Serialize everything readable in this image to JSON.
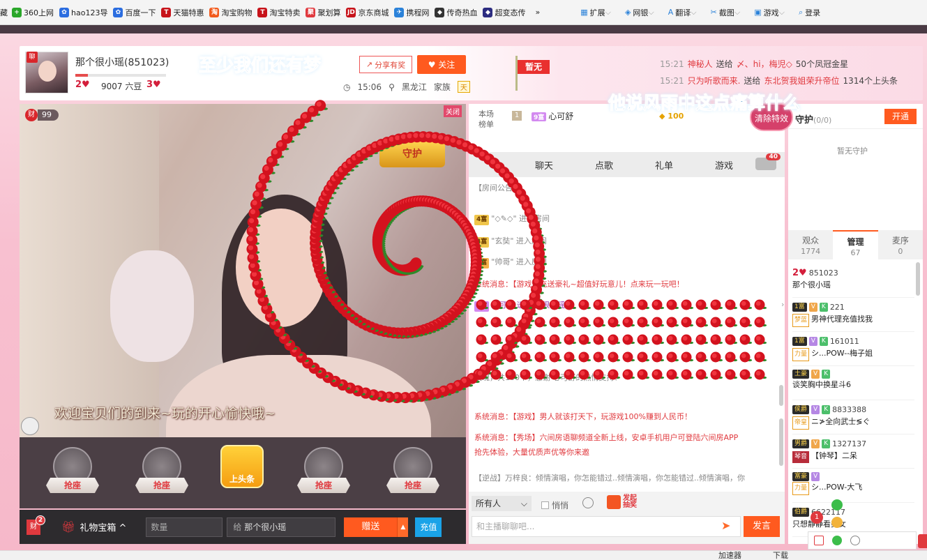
{
  "bookmarks": {
    "items": [
      {
        "label": "藏",
        "icon": "star-icon",
        "color": "#f0a500"
      },
      {
        "label": "360上网",
        "icon": "360-icon",
        "color": "#2aa72a"
      },
      {
        "label": "hao123导",
        "icon": "paw-icon",
        "color": "#2b6de0"
      },
      {
        "label": "百度一下",
        "icon": "paw-icon",
        "color": "#2b6de0"
      },
      {
        "label": "天猫特惠",
        "icon": "tmall-icon",
        "color": "#c7131a"
      },
      {
        "label": "淘宝购物",
        "icon": "taobao-icon",
        "color": "#f25a1c"
      },
      {
        "label": "淘宝特卖",
        "icon": "tmall-icon",
        "color": "#c7131a"
      },
      {
        "label": "聚划算",
        "icon": "juhuasuan-icon",
        "color": "#e0393e"
      },
      {
        "label": "京东商城",
        "icon": "jd-icon",
        "color": "#c7131a"
      },
      {
        "label": "携程网",
        "icon": "ctrip-icon",
        "color": "#2b82d9"
      },
      {
        "label": "传奇热血",
        "icon": "game-icon",
        "color": "#333333"
      },
      {
        "label": "超变态传",
        "icon": "game-icon",
        "color": "#2c2c80"
      }
    ],
    "more": "»",
    "right": [
      {
        "label": "扩展",
        "icon": "grid-icon"
      },
      {
        "label": "网银",
        "icon": "shield-icon"
      },
      {
        "label": "翻译",
        "icon": "translate-icon"
      },
      {
        "label": "截图",
        "icon": "scissors-icon"
      },
      {
        "label": "游戏",
        "icon": "gamepad-icon"
      },
      {
        "label": "登录",
        "icon": "search-icon"
      }
    ]
  },
  "anchor": {
    "badge": "聊",
    "name": "那个很小瑶(851023)",
    "level_left": "2♥",
    "beans": "9007 六豆",
    "level_right": "3♥",
    "song_left": "至少我们还有梦",
    "share_label": "分享有奖",
    "follow_label": "♥ 关注",
    "time": "15:06",
    "location": "黑龙江",
    "family_label": "家族",
    "family_tag": "天",
    "flag": "暂无"
  },
  "news": [
    {
      "time": "15:21",
      "user": "神秘人",
      "verb": "送给",
      "target": "〆、hi，梅児◇",
      "item": "50个凤冠金星"
    },
    {
      "time": "15:21",
      "user": "只为听歌而来.",
      "verb": "送给",
      "target": "东北贺我姐荣升帝位",
      "item": "1314个上头条"
    }
  ],
  "song_right": "他说风雨中这点痛算什么",
  "video": {
    "fortune_icon": "财",
    "fortune_value": "99",
    "close_label": "关闭",
    "guard_label": "守护",
    "welcome": "欢迎宝贝们的到来~玩的开心愉快哦~"
  },
  "seats": {
    "seat_label": "抢座",
    "headline": "上头条"
  },
  "giftbar": {
    "fortune": "财",
    "fortune_badge": "2",
    "giftbox": "礼物宝箱 ^",
    "qty_placeholder": "数量",
    "to_prefix": "给",
    "to_name": "那个很小瑶",
    "send": "赠送",
    "charge": "充值"
  },
  "rank": {
    "title": "本场\n榜单",
    "no": "1",
    "lvl": "9富",
    "user": "心可舒",
    "points": "100"
  },
  "tabs": [
    "聊天",
    "点歌",
    "礼单",
    "游戏"
  ],
  "car_badge": "40",
  "chat": [
    {
      "tag": "",
      "text": "【房间公告】",
      "cls": "gray"
    },
    {
      "tag": "4富",
      "text": "\"◇✎◇\" 进入房间",
      "cls": "gray"
    },
    {
      "tag": "4富",
      "text": "\"玄奘\" 进入房间",
      "cls": "gray"
    },
    {
      "tag": "5富",
      "text": "\"帅哥\" 进入房间",
      "cls": "gray"
    },
    {
      "tag": "",
      "text": "系统消息：【游戏】充送豪礼~超值好玩意儿！点来玩一玩吧！",
      "cls": "sys"
    },
    {
      "tag": "9富",
      "text": "心可舒 送 那个很小瑶",
      "cls": "purple"
    },
    {
      "tag": "",
      "text": "玫瑰，共100个，感谢 心可舒的热情支持！",
      "cls": "gray"
    },
    {
      "tag": "",
      "text": "系统消息：【游戏】男人就该打天下，玩游戏100%赚到人民币！",
      "cls": "sys"
    },
    {
      "tag": "",
      "text": "系统消息：【秀场】六间房语聊频道全新上线，安卓手机用户可登陆六间房APP",
      "cls": "sys"
    },
    {
      "tag": "",
      "text": "抢先体验，大量优质声优等你来邀",
      "cls": "sys"
    },
    {
      "tag": "",
      "text": "【逆战】万梓良：倾情演唱，你怎能错过..倾情演唱，你怎能错过..倾情演唱，你",
      "cls": "gray"
    }
  ],
  "input": {
    "scope": "所有人",
    "whisper": "悄悄",
    "lottery": "发起\n抽奖",
    "placeholder": "和主播聊聊吧...",
    "send": "发言"
  },
  "guardpanel": {
    "clear": "清除特效",
    "title": "守护",
    "count": "(0/0)",
    "open": "开通",
    "empty": "暂无守护"
  },
  "usertabs": [
    {
      "label": "观众",
      "count": "1774"
    },
    {
      "label": "管理",
      "count": "67"
    },
    {
      "label": "麦序",
      "count": "0"
    }
  ],
  "users": [
    {
      "lvl": "2♥",
      "id": "851023",
      "name": "那个很小瑶",
      "badge": "",
      "v": false,
      "k": false
    },
    {
      "lvl": "1富",
      "id": "221",
      "name": "男神代理充值找我",
      "badge": "梦蓝",
      "v": true,
      "k": true
    },
    {
      "lvl": "1富",
      "id": "161011",
      "name": "シ...POW--梅子姐",
      "badge": "力量",
      "v": true,
      "k": true
    },
    {
      "lvl": "土豪",
      "id": "",
      "name": "谈笑胸中换星斗6",
      "badge": "",
      "v": true,
      "k": true
    },
    {
      "lvl": "侯爵",
      "id": "8833388",
      "name": "ニ≯全向武士≶ぐ",
      "badge": "帝皇",
      "v": true,
      "k": true
    },
    {
      "lvl": "男爵",
      "id": "1327137",
      "name": "【钟琴】二呆",
      "badge": "琴音",
      "v": true,
      "k": true
    },
    {
      "lvl": "富豪",
      "id": "",
      "name": "シ...POW-大飞",
      "badge": "力量",
      "v": true,
      "k": false
    },
    {
      "lvl": "伯爵",
      "id": "6622117",
      "name": "只想静静看美女",
      "badge": "",
      "v": false,
      "k": false
    }
  ],
  "notif": {
    "badge": "1"
  },
  "status": {
    "accel": "加速器",
    "download": "下载"
  }
}
